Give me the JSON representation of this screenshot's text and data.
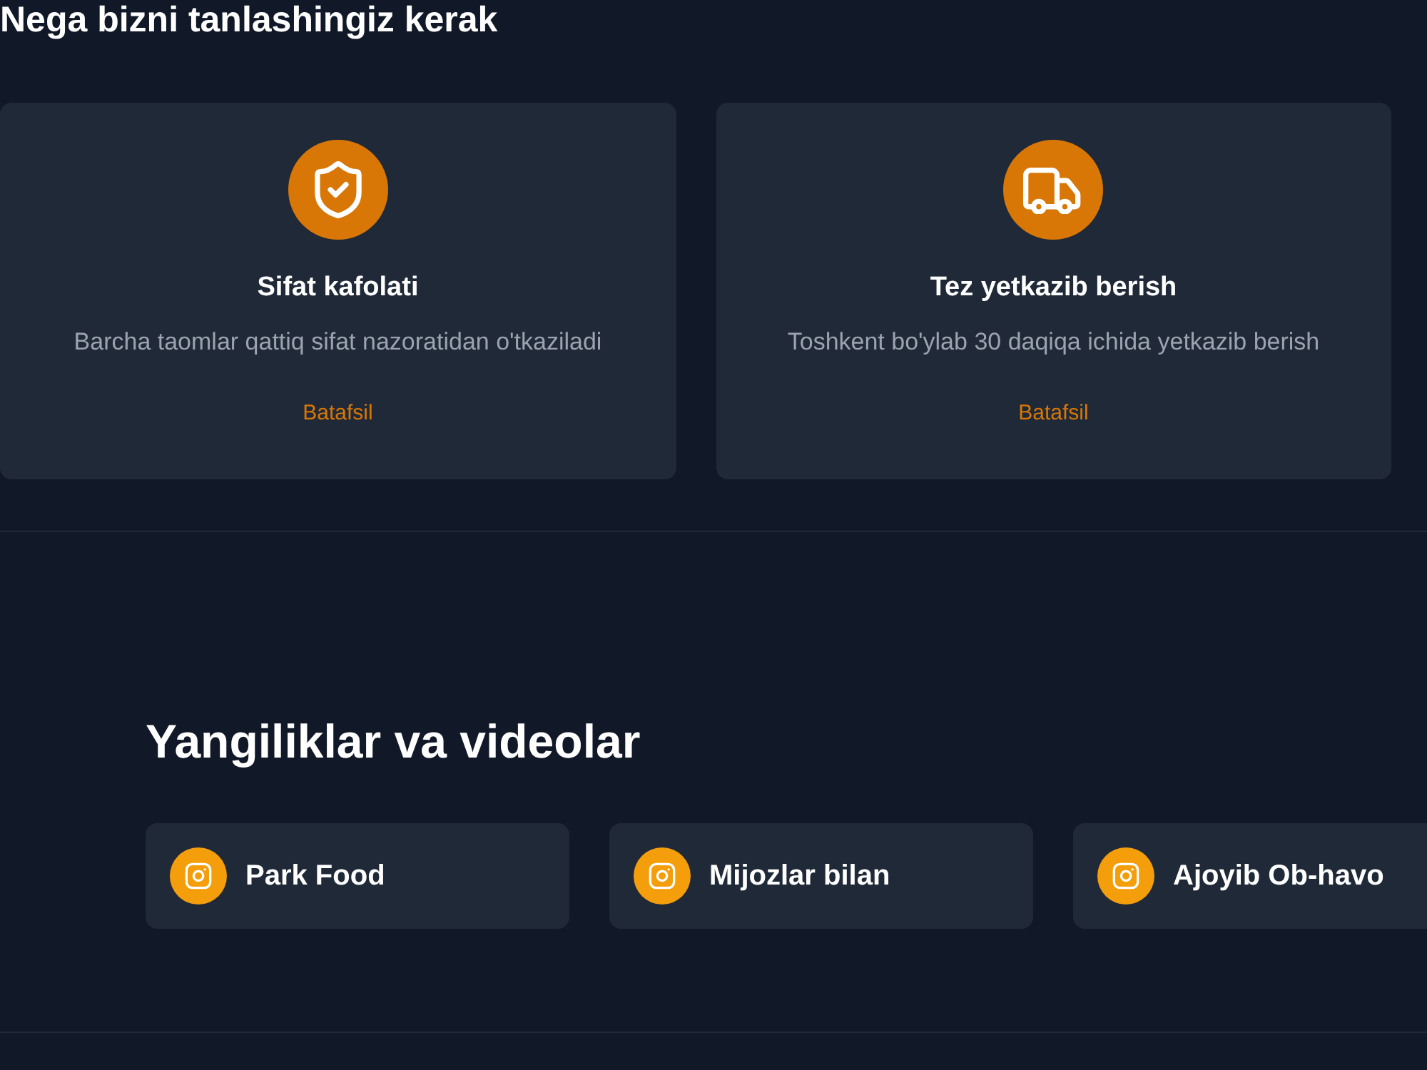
{
  "why_us": {
    "heading": "Nega bizni tanlashingiz kerak",
    "features": [
      {
        "title": "Sifat kafolati",
        "description": "Barcha taomlar qattiq sifat nazoratidan o'tkaziladi",
        "link": "Batafsil"
      },
      {
        "title": "Tez yetkazib berish",
        "description": "Toshkent bo'ylab 30 daqiqa ichida yetkazib berish",
        "link": "Batafsil"
      }
    ]
  },
  "news": {
    "heading": "Yangiliklar va videolar",
    "items": [
      {
        "title": "Park Food"
      },
      {
        "title": "Mijozlar bilan"
      },
      {
        "title": "Ajoyib Ob-havo"
      }
    ]
  }
}
